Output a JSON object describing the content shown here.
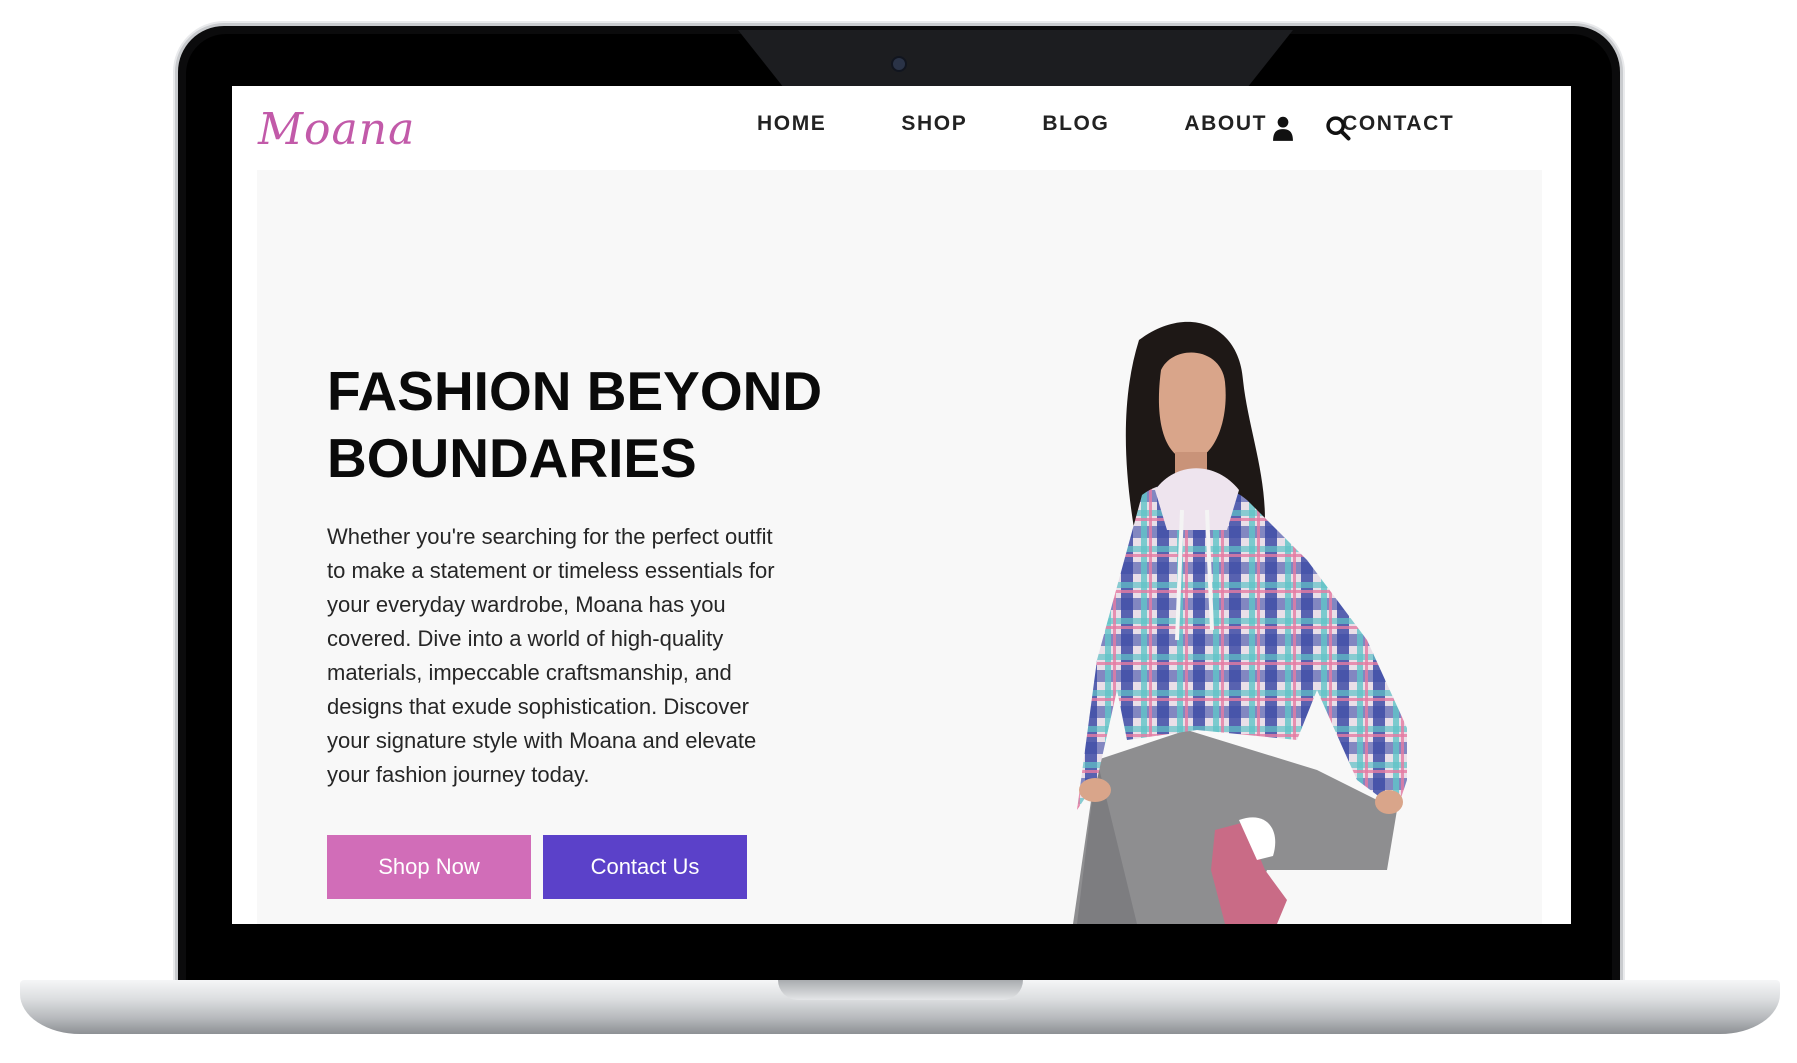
{
  "brand": {
    "logo_text": "Moana",
    "logo_color": "#c25aa9"
  },
  "nav": {
    "items": [
      {
        "label": "HOME"
      },
      {
        "label": "SHOP"
      },
      {
        "label": "BLOG"
      },
      {
        "label": "ABOUT"
      },
      {
        "label": "CONTACT"
      }
    ],
    "icons": [
      "user-icon",
      "search-icon"
    ]
  },
  "hero": {
    "title": "FASHION BEYOND BOUNDARIES",
    "description": "Whether you're searching for the perfect outfit to make a statement or timeless essentials for your everyday wardrobe, Moana has you covered. Dive into a world of high-quality materials, impeccable craftsmanship, and designs that exude sophistication. Discover your signature style with Moana and elevate your fashion journey today.",
    "primary_button": {
      "label": "Shop Now",
      "color": "#d16db8"
    },
    "secondary_button": {
      "label": "Contact Us",
      "color": "#5b41c9"
    }
  },
  "colors": {
    "background": "#f8f8f8",
    "text": "#0a0a0a"
  }
}
